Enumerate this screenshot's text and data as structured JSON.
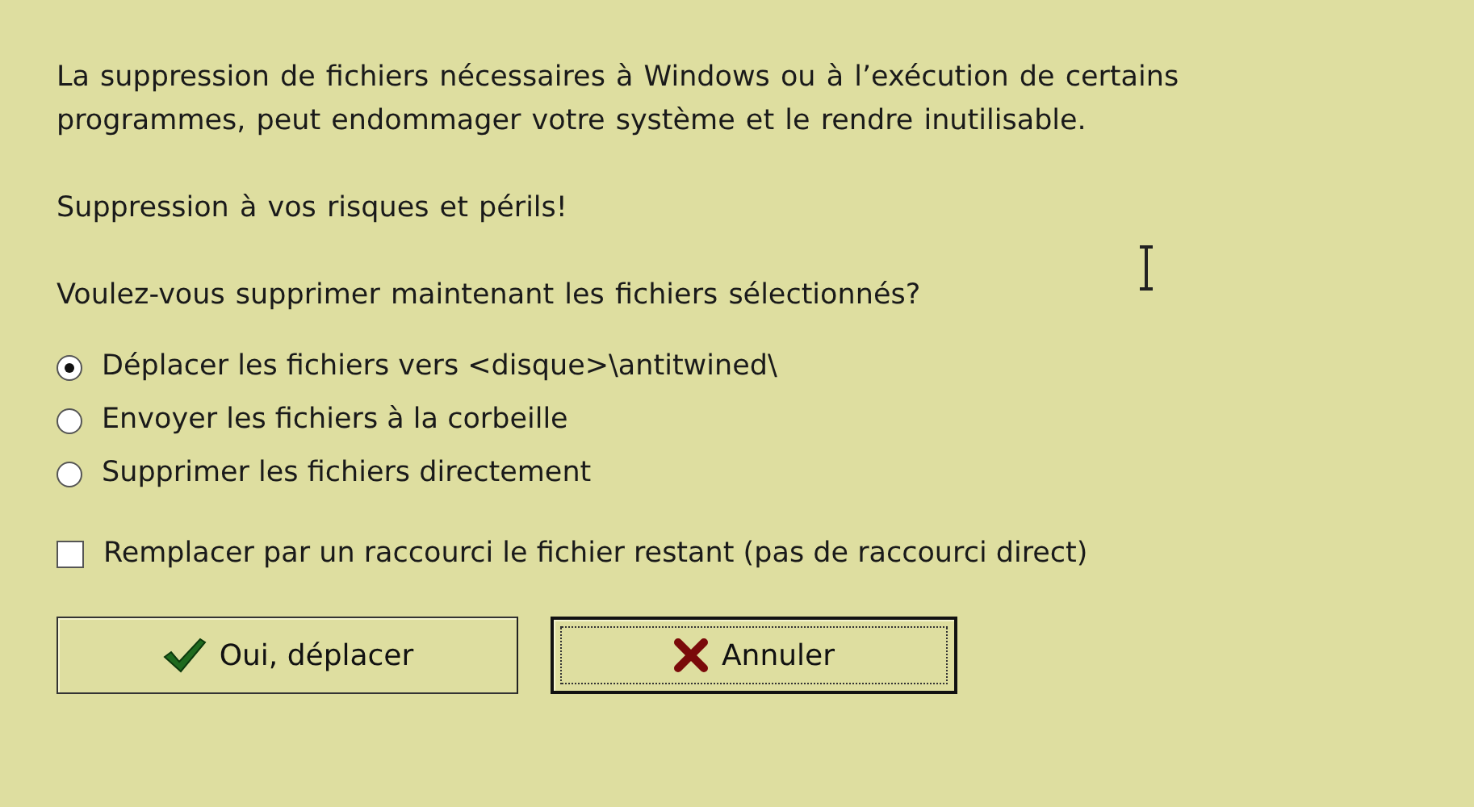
{
  "message": "La suppression de fichiers nécessaires à  Windows ou à  l’exécution de certains programmes, peut endommager votre système et le rendre inutilisable.",
  "warning": "Suppression à vos risques et périls!",
  "question": "Voulez-vous supprimer maintenant les fichiers sélectionnés?",
  "options": [
    {
      "label": "Déplacer les fichiers vers <disque>\\antitwined\\",
      "selected": true
    },
    {
      "label": "Envoyer les fichiers à la corbeille",
      "selected": false
    },
    {
      "label": "Supprimer les fichiers directement",
      "selected": false
    }
  ],
  "shortcut_option": {
    "label": "Remplacer par un raccourci le fichier restant (pas de raccourci direct)",
    "checked": false
  },
  "buttons": [
    {
      "label": "Oui, déplacer",
      "kind": "confirm",
      "default": false
    },
    {
      "label": "Annuler",
      "kind": "cancel",
      "default": true
    }
  ]
}
